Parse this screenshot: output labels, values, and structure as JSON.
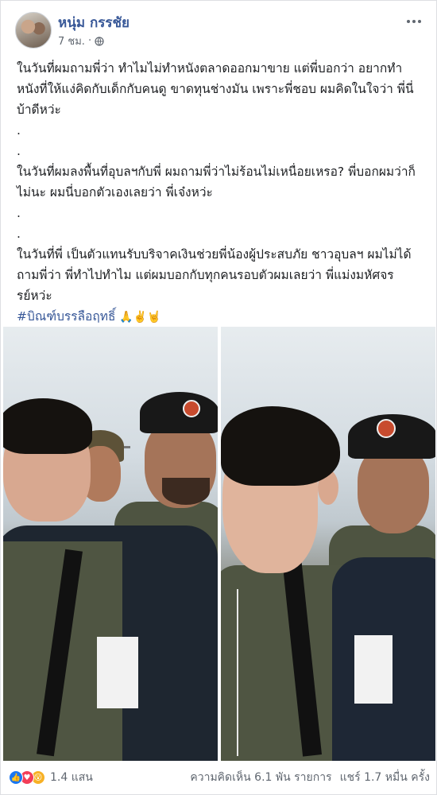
{
  "post": {
    "author": "หนุ่ม กรรชัย",
    "timestamp": "7 ชม.",
    "privacy_icon": "globe-icon",
    "paragraphs": [
      "ในวันที่ผมถามพี่ว่า ทำไมไม่ทำหนังตลาดออกมาขาย แต่พี่บอกว่า อยากทำหนังที่ให้แง่คิดกับเด็กกับคนดู ขาดทุนช่างมัน เพราะพี่ชอบ ผมคิดในใจว่า พี่นี่บ้าดีหว่ะ",
      "ในวันที่ผมลงพื้นที่อุบลฯกับพี่ ผมถามพี่ว่าไม่ร้อนไม่เหนื่อยเหรอ? พี่บอกผมว่าก็ไม่นะ ผมนี่บอกตัวเองเลยว่า พี่เจ๋งหว่ะ",
      "ในวันที่พี่ เป็นตัวแทนรับบริจาคเงินช่วยพี่น้องผู้ประสบภัย ชาวอุบลฯ ผมไม่ได้ถามพี่ว่า พี่ทำไปทำไม แต่ผมบอกกับทุกคนรอบตัวผมเลยว่า พี่แม่งมหัศจรรย์หว่ะ"
    ],
    "dot": ".",
    "hashtag": "#บิณฑ์บรรลือฤทธิ์",
    "hashtag_emojis": "🙏✌️🤘"
  },
  "footer": {
    "reaction_count": "1.4 แสน",
    "comments": "ความคิดเห็น 6.1 พัน รายการ",
    "shares": "แชร์ 1.7 หมื่น ครั้ง",
    "reactions": [
      "like",
      "love",
      "wow"
    ]
  },
  "colors": {
    "link": "#385898",
    "like": "#1877f2",
    "love": "#f33e58",
    "wow": "#f7b125"
  }
}
